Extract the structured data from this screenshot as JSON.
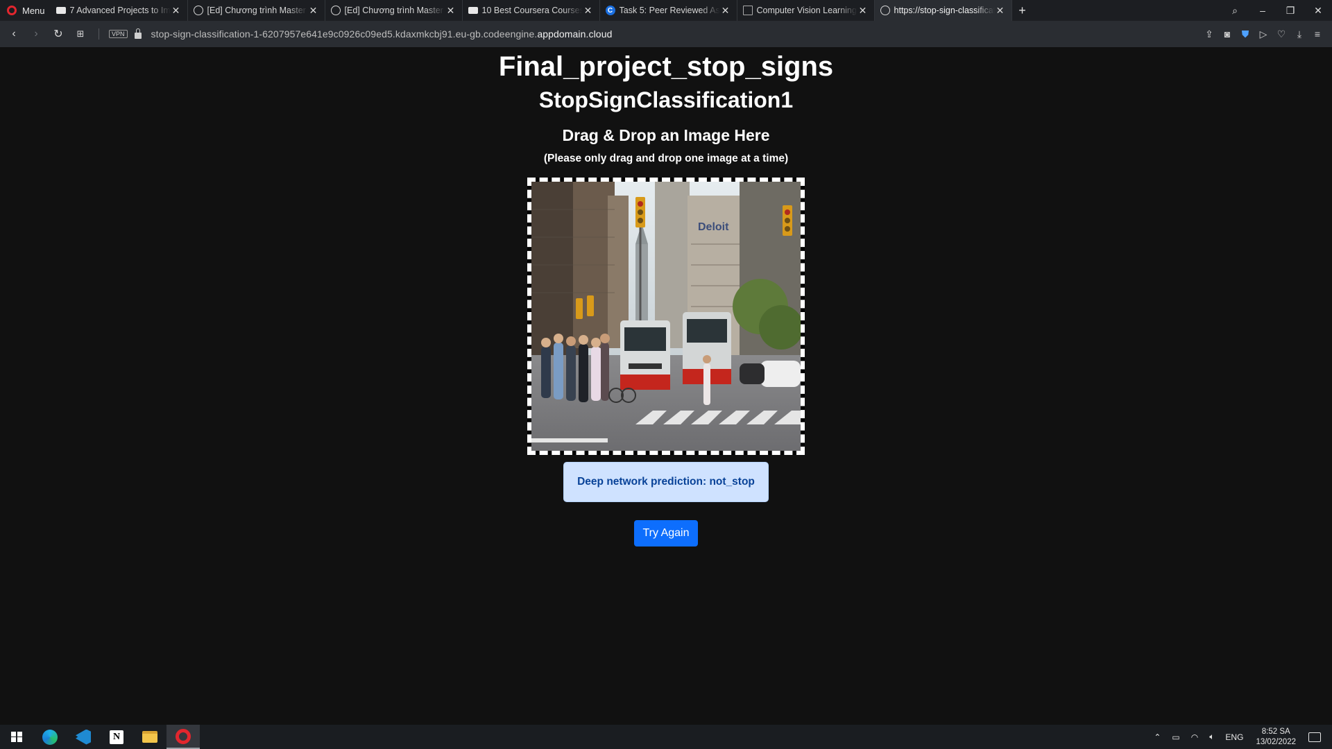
{
  "browser": {
    "menu_label": "Menu",
    "tabs": [
      {
        "title": "7 Advanced Projects to Imp",
        "icon": "camera-icon"
      },
      {
        "title": "[Ed] Chương trình Master c",
        "icon": "globe-icon"
      },
      {
        "title": "[Ed] Chương trình Master c",
        "icon": "globe-icon"
      },
      {
        "title": "10 Best Coursera Courses a",
        "icon": "camera-icon"
      },
      {
        "title": "Task 5: Peer Reviewed Assig",
        "icon": "coursera-icon"
      },
      {
        "title": "Computer Vision Learning",
        "icon": "document-icon"
      },
      {
        "title": "https://stop-sign-classificat",
        "icon": "globe-icon",
        "active": true
      }
    ],
    "vpn_label": "VPN",
    "url_prefix": "stop-sign-classification-1-6207957e641e9c0926c09ed5.kdaxmkcbj91.eu-gb.codeengine.",
    "url_domain": "appdomain.cloud"
  },
  "page": {
    "project_title": "Final_project_stop_signs",
    "model_title": "StopSignClassification1",
    "drop_heading": "Drag & Drop an Image Here",
    "drop_hint": "(Please only drag and drop one image at a time)",
    "prediction_text": "Deep network prediction: not_stop",
    "try_again_label": "Try Again"
  },
  "taskbar": {
    "language": "ENG",
    "time": "8:52 SA",
    "date": "13/02/2022"
  },
  "colors": {
    "page_bg": "#111111",
    "prediction_bg": "#cfe2ff",
    "prediction_text": "#084298",
    "button_bg": "#0d6efd"
  }
}
